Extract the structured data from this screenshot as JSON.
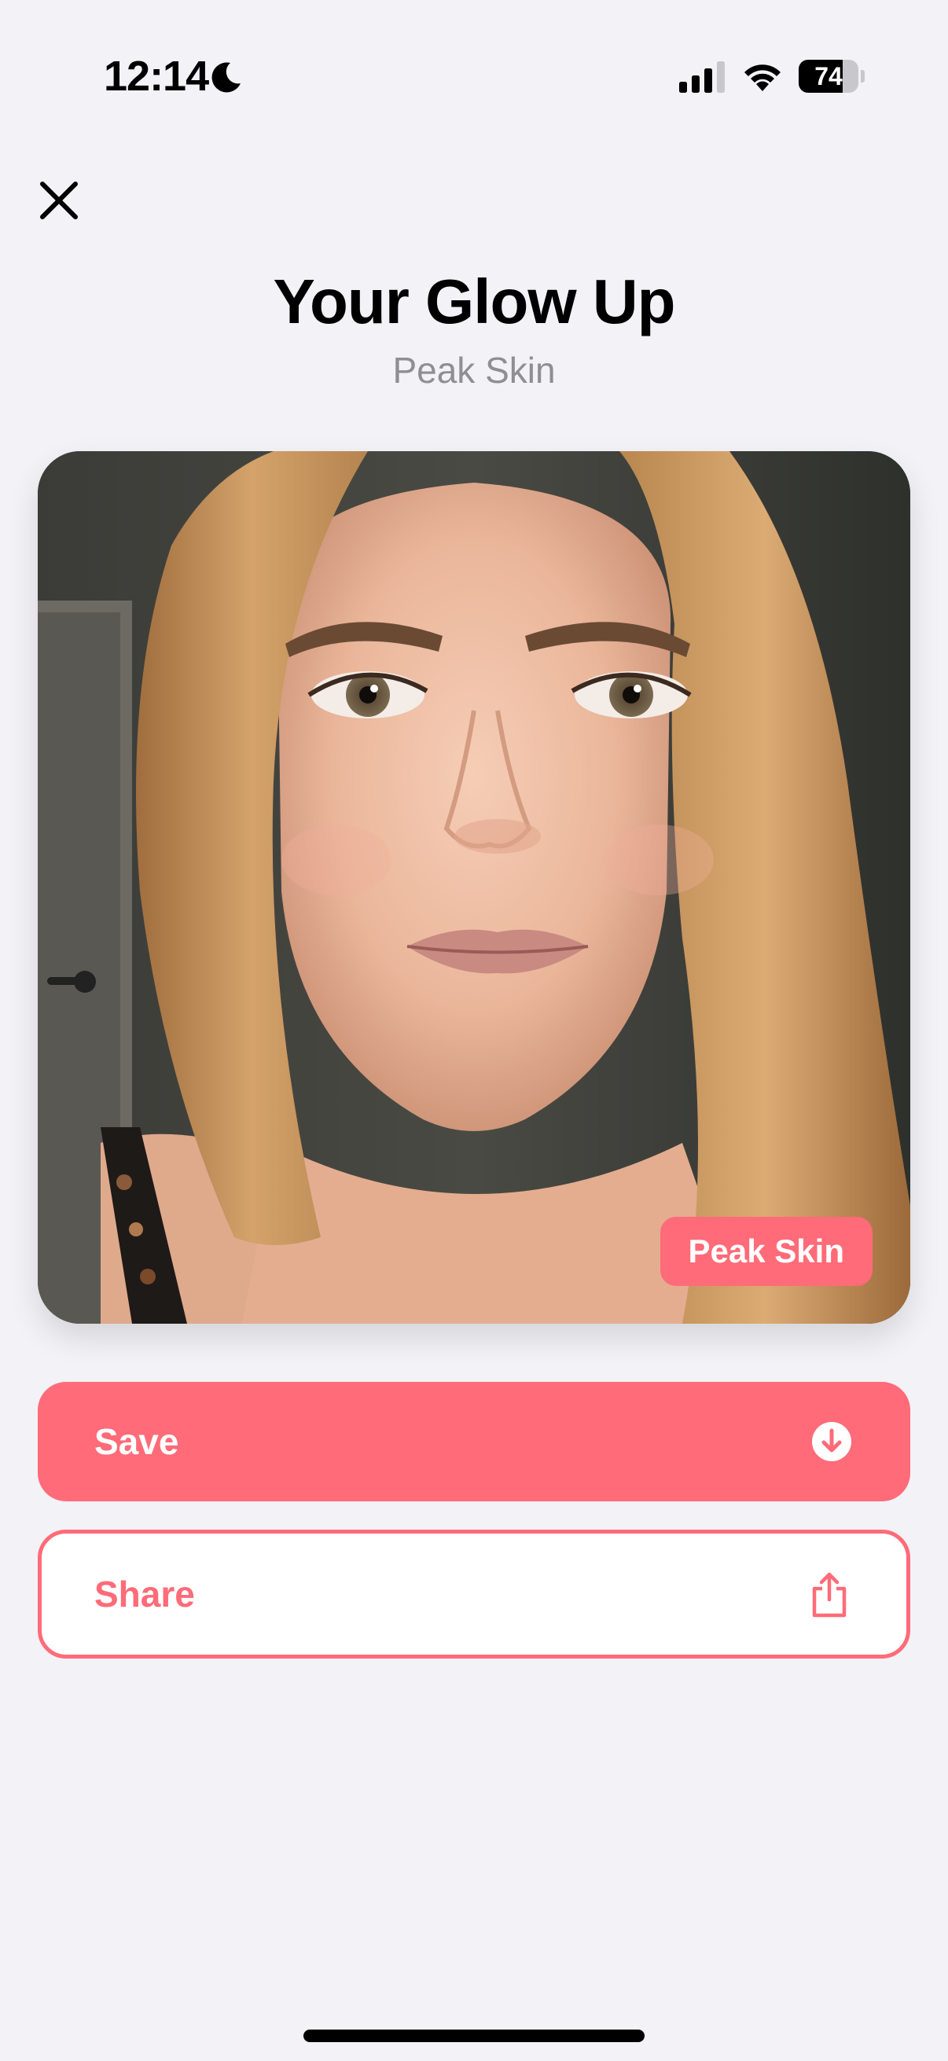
{
  "status_bar": {
    "time": "12:14",
    "battery_level": "74",
    "battery_fraction": 0.74,
    "icons": [
      "moon-icon",
      "cellular-signal-icon",
      "wifi-icon",
      "battery-icon"
    ]
  },
  "header": {
    "close_icon": "close-icon",
    "title": "Your Glow Up",
    "subtitle": "Peak Skin"
  },
  "photo": {
    "badge_label": "Peak Skin"
  },
  "actions": {
    "save_label": "Save",
    "save_icon": "download-circle-icon",
    "share_label": "Share",
    "share_icon": "share-icon"
  },
  "colors": {
    "accent": "#ff6b78",
    "background": "#f2f2f7",
    "secondary_text": "#8e8e93"
  }
}
